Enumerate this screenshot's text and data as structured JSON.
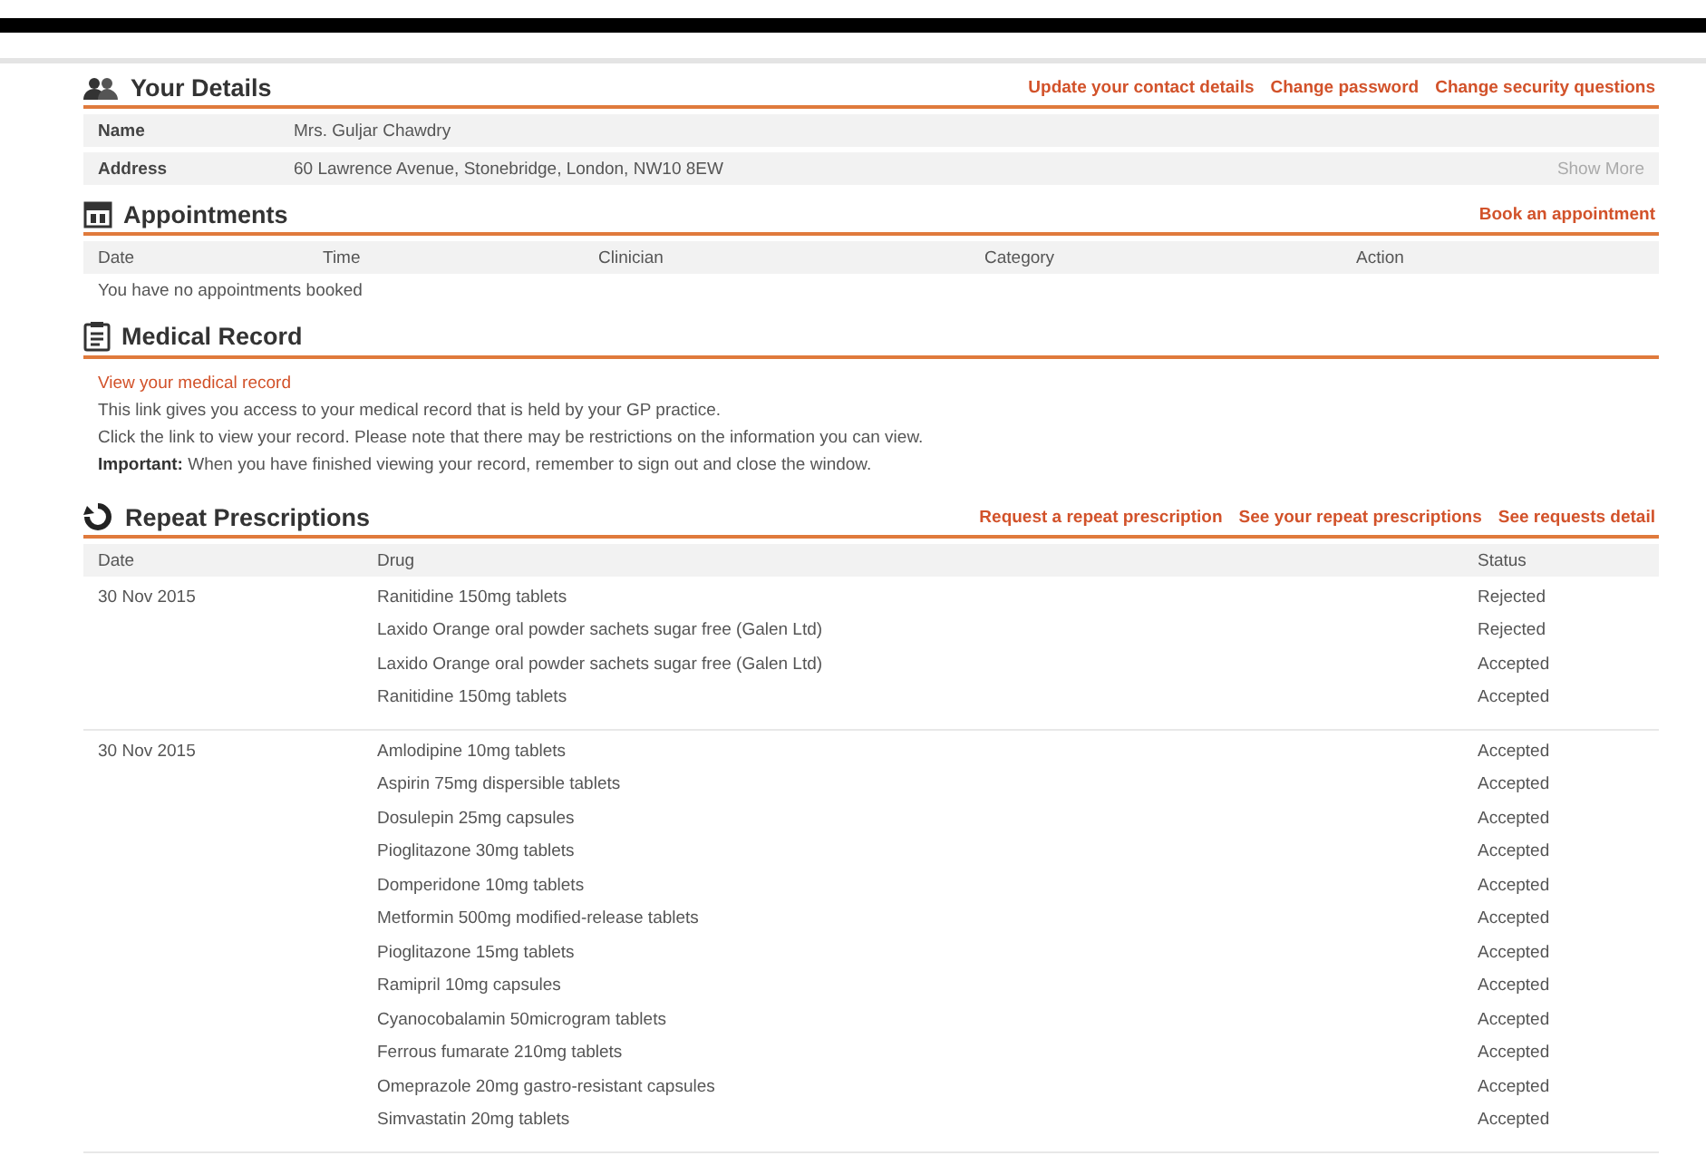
{
  "details": {
    "title": "Your Details",
    "links": [
      "Update your contact details",
      "Change password",
      "Change security questions"
    ],
    "rows": [
      {
        "label": "Name",
        "value": "Mrs. Guljar Chawdry"
      },
      {
        "label": "Address",
        "value": "60 Lawrence Avenue, Stonebridge, London, NW10 8EW",
        "action": "Show More"
      }
    ]
  },
  "appointments": {
    "title": "Appointments",
    "links": [
      "Book an appointment"
    ],
    "columns": [
      "Date",
      "Time",
      "Clinician",
      "Category",
      "Action"
    ],
    "empty": "You have no appointments booked"
  },
  "medical_record": {
    "title": "Medical Record",
    "link": "View your medical record",
    "lines": [
      "This link gives you access to your medical record that is held by your GP practice.",
      "Click the link to view your record. Please note that there may be restrictions on the information you can view.",
      "**Important:** When you have finished viewing your record, remember to sign out and close the window."
    ]
  },
  "prescriptions": {
    "title": "Repeat Prescriptions",
    "links": [
      "Request a repeat prescription",
      "See your repeat prescriptions",
      "See requests detail"
    ],
    "columns": [
      "Date",
      "Drug",
      "Status"
    ],
    "groups": [
      {
        "date": "30 Nov 2015",
        "items": [
          {
            "drug": "Ranitidine 150mg tablets",
            "status": "Rejected"
          },
          {
            "drug": "Laxido Orange oral powder sachets sugar free (Galen Ltd)",
            "status": "Rejected"
          },
          {
            "drug": "Laxido Orange oral powder sachets sugar free (Galen Ltd)",
            "status": "Accepted"
          },
          {
            "drug": "Ranitidine 150mg tablets",
            "status": "Accepted"
          }
        ]
      },
      {
        "date": "30 Nov 2015",
        "items": [
          {
            "drug": "Amlodipine 10mg tablets",
            "status": "Accepted"
          },
          {
            "drug": "Aspirin 75mg dispersible tablets",
            "status": "Accepted"
          },
          {
            "drug": "Dosulepin 25mg capsules",
            "status": "Accepted"
          },
          {
            "drug": "Pioglitazone 30mg tablets",
            "status": "Accepted"
          },
          {
            "drug": "Domperidone 10mg tablets",
            "status": "Accepted"
          },
          {
            "drug": "Metformin 500mg modified-release tablets",
            "status": "Accepted"
          },
          {
            "drug": "Pioglitazone 15mg tablets",
            "status": "Accepted"
          },
          {
            "drug": "Ramipril 10mg capsules",
            "status": "Accepted"
          },
          {
            "drug": "Cyanocobalamin 50microgram tablets",
            "status": "Accepted"
          },
          {
            "drug": "Ferrous fumarate 210mg tablets",
            "status": "Accepted"
          },
          {
            "drug": "Omeprazole 20mg gastro-resistant capsules",
            "status": "Accepted"
          },
          {
            "drug": "Simvastatin 20mg tablets",
            "status": "Accepted"
          }
        ]
      }
    ]
  }
}
